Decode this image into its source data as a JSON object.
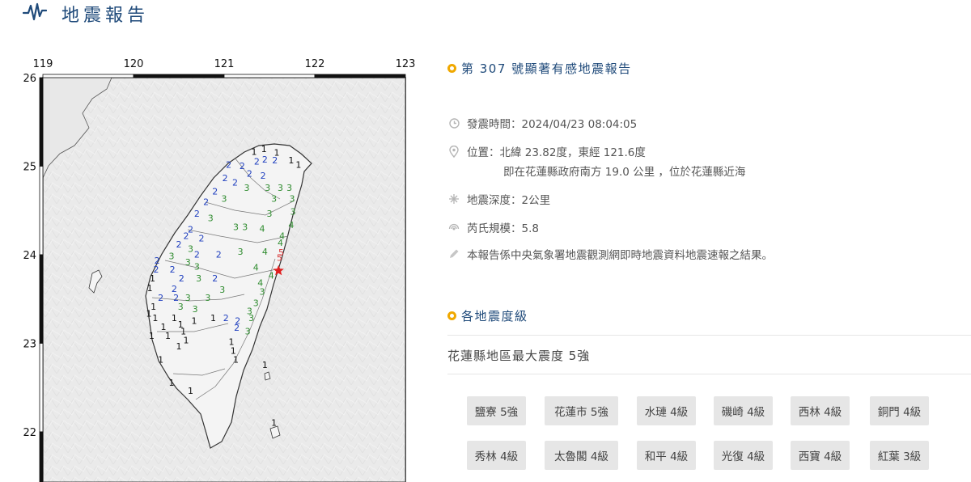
{
  "header": {
    "title": "地震報告",
    "logo_icon": "seismograph-wave-icon"
  },
  "map": {
    "lon_ticks": [
      "119",
      "120",
      "121",
      "122",
      "123"
    ],
    "lat_ticks": [
      "26",
      "25",
      "24",
      "23",
      "22"
    ],
    "epicenter": {
      "lon": 121.6,
      "lat": 23.82
    },
    "stations": [
      {
        "v": "1",
        "c": "#111",
        "lon": 121.33,
        "lat": 25.13
      },
      {
        "v": "1",
        "c": "#111",
        "lon": 121.44,
        "lat": 25.16
      },
      {
        "v": "1",
        "c": "#111",
        "lon": 121.58,
        "lat": 25.12
      },
      {
        "v": "2",
        "c": "#1f3fbf",
        "lon": 121.45,
        "lat": 25.04
      },
      {
        "v": "2",
        "c": "#1f3fbf",
        "lon": 121.36,
        "lat": 25.02
      },
      {
        "v": "2",
        "c": "#1f3fbf",
        "lon": 121.56,
        "lat": 25.03
      },
      {
        "v": "1",
        "c": "#111",
        "lon": 121.74,
        "lat": 25.03
      },
      {
        "v": "2",
        "c": "#1f3fbf",
        "lon": 121.2,
        "lat": 24.97
      },
      {
        "v": "2",
        "c": "#1f3fbf",
        "lon": 121.05,
        "lat": 24.98
      },
      {
        "v": "1",
        "c": "#111",
        "lon": 121.82,
        "lat": 24.98
      },
      {
        "v": "2",
        "c": "#1f3fbf",
        "lon": 121.28,
        "lat": 24.88
      },
      {
        "v": "2",
        "c": "#1f3fbf",
        "lon": 121.43,
        "lat": 24.86
      },
      {
        "v": "2",
        "c": "#1f3fbf",
        "lon": 121.01,
        "lat": 24.83
      },
      {
        "v": "2",
        "c": "#1f3fbf",
        "lon": 121.12,
        "lat": 24.78
      },
      {
        "v": "3",
        "c": "#2e8b2e",
        "lon": 121.25,
        "lat": 24.72
      },
      {
        "v": "3",
        "c": "#2e8b2e",
        "lon": 121.48,
        "lat": 24.72
      },
      {
        "v": "3",
        "c": "#2e8b2e",
        "lon": 121.62,
        "lat": 24.72
      },
      {
        "v": "3",
        "c": "#2e8b2e",
        "lon": 121.72,
        "lat": 24.72
      },
      {
        "v": "3",
        "c": "#2e8b2e",
        "lon": 121.75,
        "lat": 24.6
      },
      {
        "v": "3",
        "c": "#2e8b2e",
        "lon": 121.55,
        "lat": 24.6
      },
      {
        "v": "2",
        "c": "#1f3fbf",
        "lon": 120.9,
        "lat": 24.68
      },
      {
        "v": "3",
        "c": "#2e8b2e",
        "lon": 121.0,
        "lat": 24.6
      },
      {
        "v": "2",
        "c": "#1f3fbf",
        "lon": 120.8,
        "lat": 24.56
      },
      {
        "v": "2",
        "c": "#1f3fbf",
        "lon": 120.7,
        "lat": 24.43
      },
      {
        "v": "3",
        "c": "#2e8b2e",
        "lon": 120.85,
        "lat": 24.38
      },
      {
        "v": "3",
        "c": "#2e8b2e",
        "lon": 121.5,
        "lat": 24.43
      },
      {
        "v": "3",
        "c": "#2e8b2e",
        "lon": 121.76,
        "lat": 24.45
      },
      {
        "v": "4",
        "c": "#2e8b2e",
        "lon": 121.74,
        "lat": 24.3
      },
      {
        "v": "3",
        "c": "#2e8b2e",
        "lon": 121.13,
        "lat": 24.28
      },
      {
        "v": "3",
        "c": "#2e8b2e",
        "lon": 121.23,
        "lat": 24.28
      },
      {
        "v": "4",
        "c": "#2e8b2e",
        "lon": 121.42,
        "lat": 24.26
      },
      {
        "v": "2",
        "c": "#1f3fbf",
        "lon": 120.63,
        "lat": 24.25
      },
      {
        "v": "2",
        "c": "#1f3fbf",
        "lon": 120.58,
        "lat": 24.18
      },
      {
        "v": "2",
        "c": "#1f3fbf",
        "lon": 120.75,
        "lat": 24.15
      },
      {
        "v": "4",
        "c": "#2e8b2e",
        "lon": 121.64,
        "lat": 24.18
      },
      {
        "v": "4",
        "c": "#2e8b2e",
        "lon": 121.62,
        "lat": 24.1
      },
      {
        "v": "2",
        "c": "#1f3fbf",
        "lon": 120.5,
        "lat": 24.08
      },
      {
        "v": "3",
        "c": "#2e8b2e",
        "lon": 120.63,
        "lat": 24.03
      },
      {
        "v": "3",
        "c": "#2e8b2e",
        "lon": 121.18,
        "lat": 24.0
      },
      {
        "v": "4",
        "c": "#2e8b2e",
        "lon": 121.45,
        "lat": 24.0
      },
      {
        "v": "5",
        "c": "#d93b3b",
        "lon": 121.63,
        "lat": 23.99
      },
      {
        "v": "5",
        "c": "#d93b3b",
        "lon": 121.61,
        "lat": 23.93
      },
      {
        "v": "2",
        "c": "#1f3fbf",
        "lon": 120.7,
        "lat": 23.97
      },
      {
        "v": "2",
        "c": "#1f3fbf",
        "lon": 120.94,
        "lat": 23.97
      },
      {
        "v": "3",
        "c": "#2e8b2e",
        "lon": 120.42,
        "lat": 23.95
      },
      {
        "v": "2",
        "c": "#1f3fbf",
        "lon": 120.26,
        "lat": 23.9
      },
      {
        "v": "3",
        "c": "#2e8b2e",
        "lon": 120.6,
        "lat": 23.88
      },
      {
        "v": "2",
        "c": "#1f3fbf",
        "lon": 120.25,
        "lat": 23.8
      },
      {
        "v": "2",
        "c": "#1f3fbf",
        "lon": 120.43,
        "lat": 23.8
      },
      {
        "v": "3",
        "c": "#2e8b2e",
        "lon": 120.7,
        "lat": 23.83
      },
      {
        "v": "4",
        "c": "#2e8b2e",
        "lon": 121.35,
        "lat": 23.82
      },
      {
        "v": "4",
        "c": "#2e8b2e",
        "lon": 121.52,
        "lat": 23.73
      },
      {
        "v": "1",
        "c": "#111",
        "lon": 120.21,
        "lat": 23.7
      },
      {
        "v": "2",
        "c": "#1f3fbf",
        "lon": 120.53,
        "lat": 23.7
      },
      {
        "v": "3",
        "c": "#2e8b2e",
        "lon": 120.72,
        "lat": 23.7
      },
      {
        "v": "2",
        "c": "#1f3fbf",
        "lon": 120.9,
        "lat": 23.7
      },
      {
        "v": "4",
        "c": "#2e8b2e",
        "lon": 121.4,
        "lat": 23.65
      },
      {
        "v": "1",
        "c": "#111",
        "lon": 120.18,
        "lat": 23.59
      },
      {
        "v": "2",
        "c": "#1f3fbf",
        "lon": 120.45,
        "lat": 23.58
      },
      {
        "v": "3",
        "c": "#2e8b2e",
        "lon": 120.98,
        "lat": 23.57
      },
      {
        "v": "3",
        "c": "#2e8b2e",
        "lon": 121.42,
        "lat": 23.55
      },
      {
        "v": "2",
        "c": "#1f3fbf",
        "lon": 120.3,
        "lat": 23.48
      },
      {
        "v": "2",
        "c": "#1f3fbf",
        "lon": 120.47,
        "lat": 23.48
      },
      {
        "v": "3",
        "c": "#2e8b2e",
        "lon": 120.6,
        "lat": 23.48
      },
      {
        "v": "3",
        "c": "#2e8b2e",
        "lon": 120.82,
        "lat": 23.48
      },
      {
        "v": "3",
        "c": "#2e8b2e",
        "lon": 121.35,
        "lat": 23.42
      },
      {
        "v": "1",
        "c": "#111",
        "lon": 120.22,
        "lat": 23.38
      },
      {
        "v": "3",
        "c": "#2e8b2e",
        "lon": 120.52,
        "lat": 23.38
      },
      {
        "v": "3",
        "c": "#2e8b2e",
        "lon": 120.68,
        "lat": 23.35
      },
      {
        "v": "3",
        "c": "#2e8b2e",
        "lon": 121.28,
        "lat": 23.33
      },
      {
        "v": "1",
        "c": "#111",
        "lon": 120.17,
        "lat": 23.3
      },
      {
        "v": "1",
        "c": "#111",
        "lon": 120.24,
        "lat": 23.25
      },
      {
        "v": "1",
        "c": "#111",
        "lon": 120.45,
        "lat": 23.25
      },
      {
        "v": "1",
        "c": "#111",
        "lon": 120.67,
        "lat": 23.22
      },
      {
        "v": "1",
        "c": "#111",
        "lon": 120.88,
        "lat": 23.25
      },
      {
        "v": "2",
        "c": "#1f3fbf",
        "lon": 121.02,
        "lat": 23.25
      },
      {
        "v": "2",
        "c": "#1f3fbf",
        "lon": 121.15,
        "lat": 23.22
      },
      {
        "v": "3",
        "c": "#2e8b2e",
        "lon": 121.3,
        "lat": 23.25
      },
      {
        "v": "1",
        "c": "#111",
        "lon": 120.33,
        "lat": 23.15
      },
      {
        "v": "1",
        "c": "#111",
        "lon": 120.52,
        "lat": 23.18
      },
      {
        "v": "1",
        "c": "#111",
        "lon": 120.55,
        "lat": 23.1
      },
      {
        "v": "2",
        "c": "#1f3fbf",
        "lon": 121.14,
        "lat": 23.14
      },
      {
        "v": "3",
        "c": "#2e8b2e",
        "lon": 121.26,
        "lat": 23.1
      },
      {
        "v": "1",
        "c": "#111",
        "lon": 120.2,
        "lat": 23.05
      },
      {
        "v": "1",
        "c": "#111",
        "lon": 120.38,
        "lat": 23.05
      },
      {
        "v": "1",
        "c": "#111",
        "lon": 120.58,
        "lat": 23.0
      },
      {
        "v": "1",
        "c": "#111",
        "lon": 121.08,
        "lat": 22.98
      },
      {
        "v": "1",
        "c": "#111",
        "lon": 120.5,
        "lat": 22.93
      },
      {
        "v": "1",
        "c": "#111",
        "lon": 121.1,
        "lat": 22.88
      },
      {
        "v": "1",
        "c": "#111",
        "lon": 120.3,
        "lat": 22.78
      },
      {
        "v": "1",
        "c": "#111",
        "lon": 121.13,
        "lat": 22.78
      },
      {
        "v": "1",
        "c": "#111",
        "lon": 121.45,
        "lat": 22.72
      },
      {
        "v": "1",
        "c": "#111",
        "lon": 120.42,
        "lat": 22.52
      },
      {
        "v": "1",
        "c": "#111",
        "lon": 120.63,
        "lat": 22.43
      },
      {
        "v": "1",
        "c": "#111",
        "lon": 121.55,
        "lat": 22.07
      }
    ]
  },
  "report": {
    "title": "第 307 號顯著有感地震報告",
    "time_label": "發震時間：2024/04/23 08:04:05",
    "location_label": "位置：北緯 23.82度，東經 121.6度",
    "location_sub": "即在花蓮縣政府南方 19.0 公里 ，位於花蓮縣近海",
    "depth_label": "地震深度：2公里",
    "magnitude_label": "芮氏規模：5.8",
    "note": "本報告係中央氣象署地震觀測網即時地震資料地震速報之結果。"
  },
  "intensity": {
    "section_title": "各地震度級",
    "max_line": "花蓮縣地區最大震度 5強",
    "badges": [
      "鹽寮 5強",
      "花蓮市 5強",
      "水璉 4級",
      "磯崎 4級",
      "西林 4級",
      "銅門 4級",
      "秀林 4級",
      "太魯閣 4級",
      "和平 4級",
      "光復 4級",
      "西寶 4級",
      "紅葉 3級"
    ]
  },
  "colors": {
    "accent": "#1f4a7a",
    "dot": "#f0a800",
    "epicenter": "#e02020"
  }
}
